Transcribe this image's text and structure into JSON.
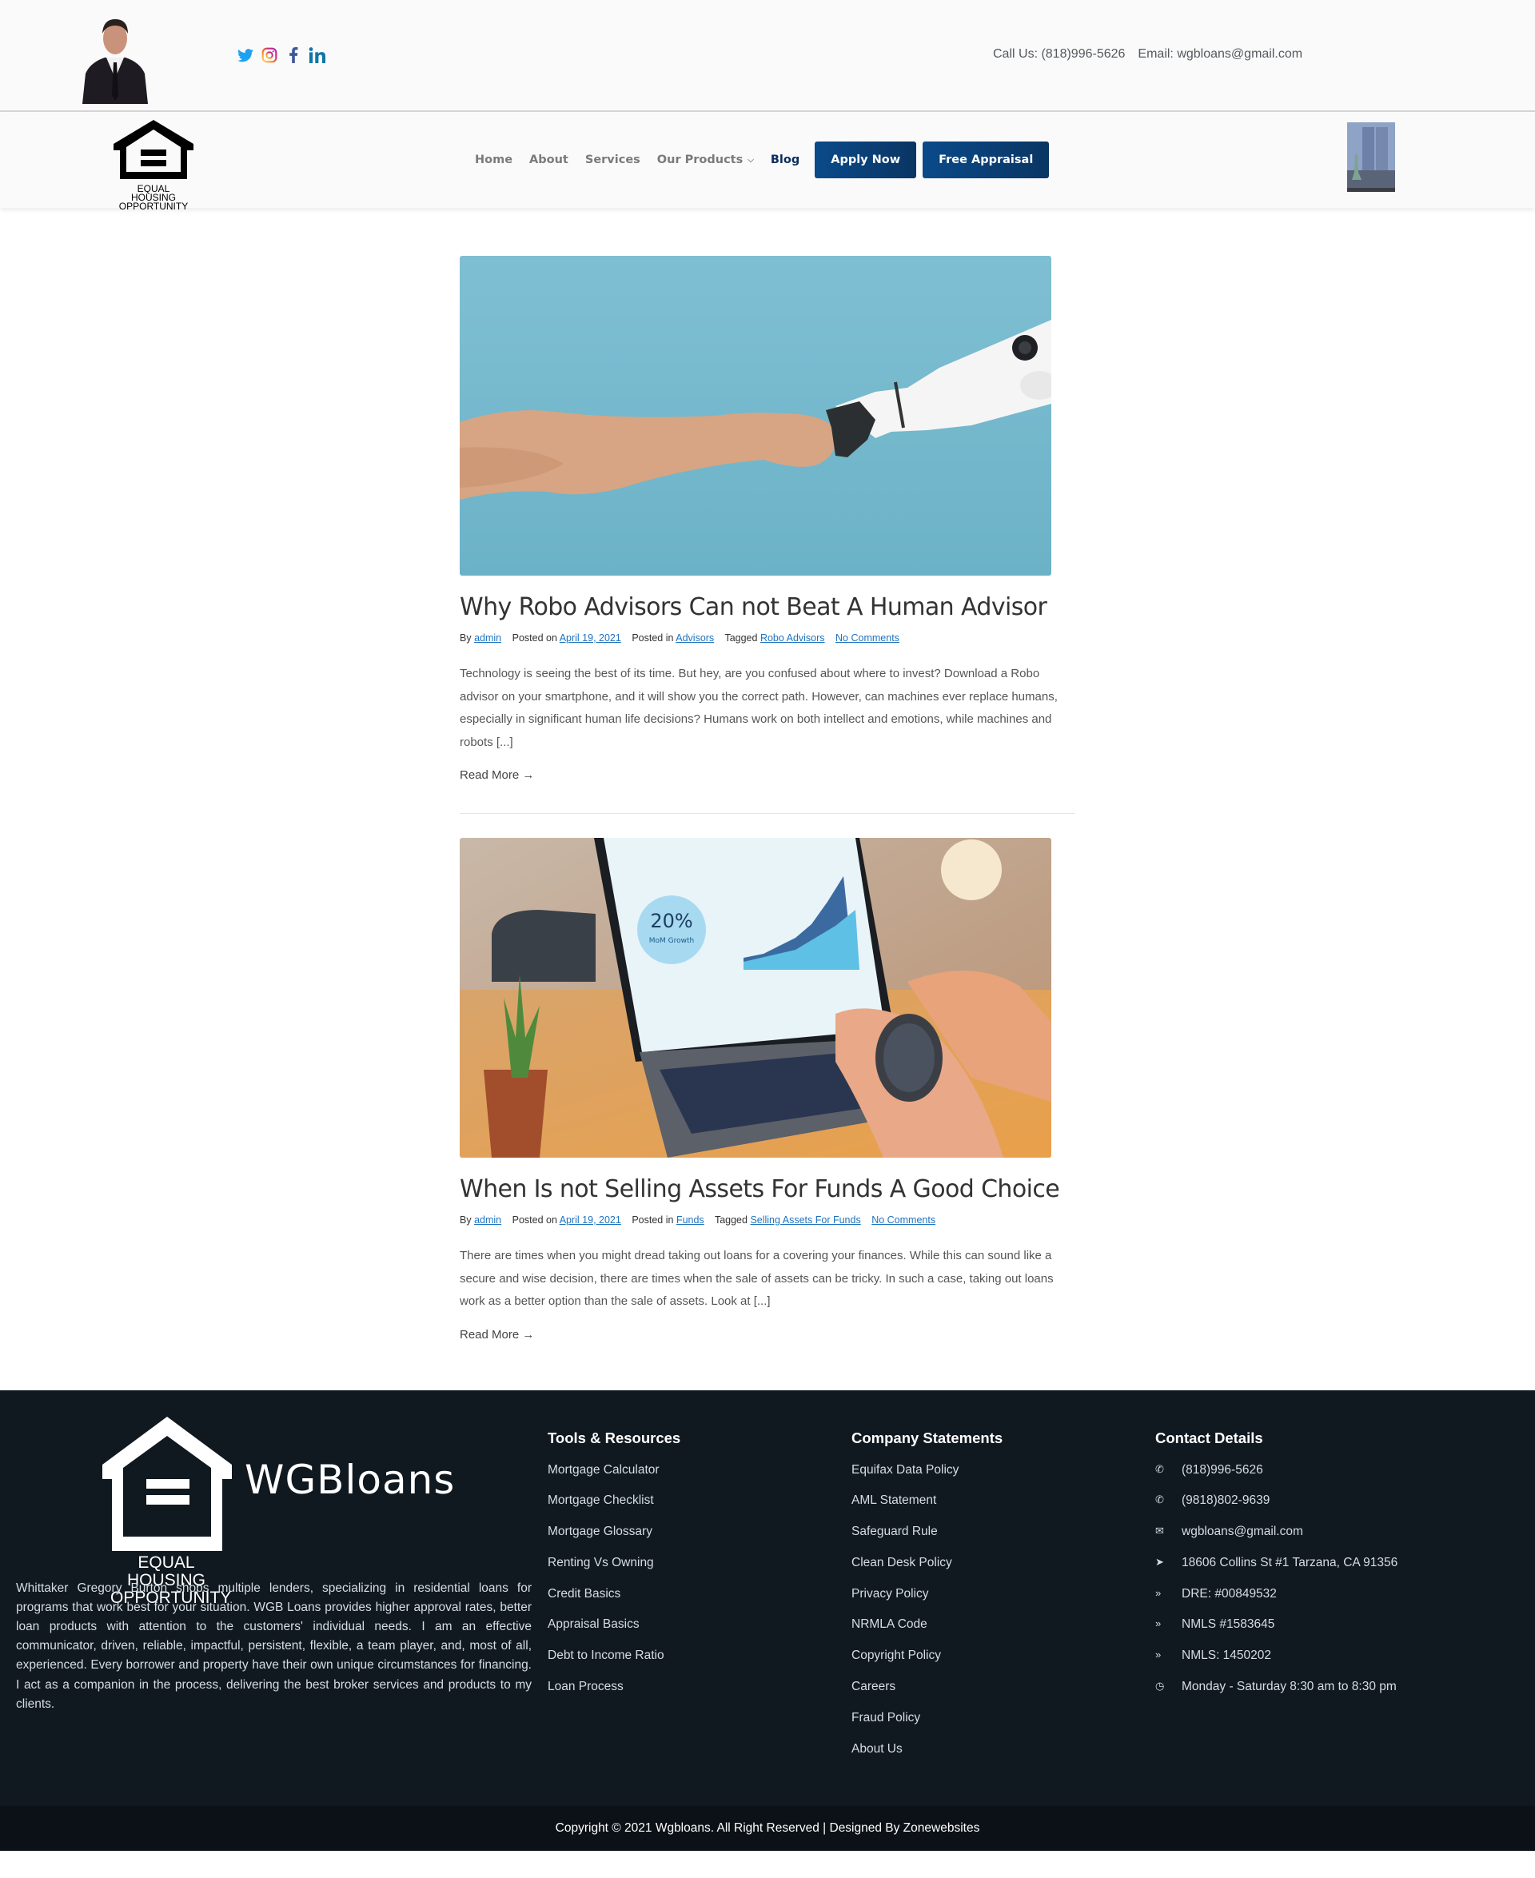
{
  "topbar": {
    "avatar_alt": "Whittaker Gregory Burton",
    "social": [
      {
        "name": "twitter-icon",
        "color": "#1da1f2"
      },
      {
        "name": "instagram-icon",
        "color": "#e1306c"
      },
      {
        "name": "facebook-icon",
        "color": "#3b5998"
      },
      {
        "name": "linkedin-icon",
        "color": "#0e76a8"
      }
    ],
    "call_us": "Call Us: (818)996-5626",
    "email": "Email: wgbloans@gmail.com"
  },
  "navbar": {
    "logo_line1": "EQUAL HOUSING",
    "logo_line2": "OPPORTUNITY",
    "links": [
      {
        "label": "Home",
        "active": false
      },
      {
        "label": "About",
        "active": false
      },
      {
        "label": "Services",
        "active": false
      },
      {
        "label": "Our Products",
        "active": false,
        "dropdown": true
      },
      {
        "label": "Blog",
        "active": true
      }
    ],
    "chevron": "⌄",
    "apply_now": "Apply Now",
    "free_appraisal": "Free Appraisal",
    "accent": "#0a4a8a"
  },
  "posts": [
    {
      "title": "Why Robo Advisors Can not Beat A Human Advisor",
      "by": "By",
      "author": "admin",
      "posted_on": "Posted on",
      "date": "April 19, 2021",
      "posted_in": "Posted in",
      "category": "Advisors",
      "tagged": "Tagged",
      "tag": "Robo Advisors",
      "comments": "No Comments",
      "excerpt": "Technology is seeing the best of its time. But hey, are you confused about where to invest? Download a Robo advisor on your smartphone, and it will show you the correct path. However, can machines ever replace humans, especially in significant human life decisions? Humans work on both intellect and emotions, while machines and robots [...]",
      "read_more": "Read More →"
    },
    {
      "title": "When Is not Selling Assets For Funds A Good Choice",
      "by": "By",
      "author": "admin",
      "posted_on": "Posted on",
      "date": "April 19, 2021",
      "posted_in": "Posted in",
      "category": "Funds",
      "tagged": "Tagged",
      "tag": "Selling Assets For Funds",
      "comments": "No Comments",
      "excerpt": "There are times when you might dread taking out loans for a covering your finances. While this can sound like a secure and wise decision, there are times when the sale of assets can be tricky. In such a case, taking out loans work as a better option than the sale of assets. Look at [...]",
      "read_more": "Read More →",
      "image_overlay": {
        "percent": "20%",
        "label": "MoM Growth"
      }
    }
  ],
  "footer": {
    "brand": "WGBloans",
    "logo_line1": "EQUAL HOUSING",
    "logo_line2": "OPPORTUNITY",
    "about": "Whittaker Gregory Burton shops multiple lenders, specializing in residential loans for programs that work best for your situation. WGB Loans provides higher approval rates, better loan products with attention to the customers' individual needs. I am an effective communicator, driven, reliable, impactful, persistent, flexible, a team player, and, most of all, experienced. Every borrower and property have their own unique circumstances for financing. I act as a companion in the process, delivering the best broker services and products to my clients.",
    "tools": {
      "heading": "Tools & Resources",
      "items": [
        "Mortgage Calculator",
        "Mortgage Checklist",
        "Mortgage Glossary",
        "Renting Vs Owning",
        "Credit Basics",
        "Appraisal Basics",
        "Debt to Income Ratio",
        "Loan Process"
      ]
    },
    "company": {
      "heading": "Company Statements",
      "items": [
        "Equifax Data Policy",
        "AML Statement",
        "Safeguard Rule",
        "Clean Desk Policy",
        "Privacy Policy",
        "NRMLA Code",
        "Copyright Policy",
        "Careers",
        "Fraud Policy",
        "About Us"
      ]
    },
    "contact": {
      "heading": "Contact Details",
      "items": [
        {
          "icon": "phone-icon",
          "glyph": "✆",
          "text": "(818)996-5626"
        },
        {
          "icon": "phone-icon",
          "glyph": "✆",
          "text": "(9818)802-9639"
        },
        {
          "icon": "envelope-icon",
          "glyph": "✉",
          "text": "wgbloans@gmail.com"
        },
        {
          "icon": "location-arrow-icon",
          "glyph": "➤",
          "text": "18606 Collins St #1 Tarzana, CA 91356"
        },
        {
          "icon": "double-chevron-icon",
          "glyph": "»",
          "text": "DRE: #00849532"
        },
        {
          "icon": "double-chevron-icon",
          "glyph": "»",
          "text": "NMLS #1583645"
        },
        {
          "icon": "double-chevron-icon",
          "glyph": "»",
          "text": "NMLS: 1450202"
        },
        {
          "icon": "clock-icon",
          "glyph": "◷",
          "text": "Monday - Saturday 8:30 am to 8:30 pm"
        }
      ]
    },
    "copyright": "Copyright © 2021 Wgbloans. All Right Reserved | Designed By Zonewebsites"
  }
}
